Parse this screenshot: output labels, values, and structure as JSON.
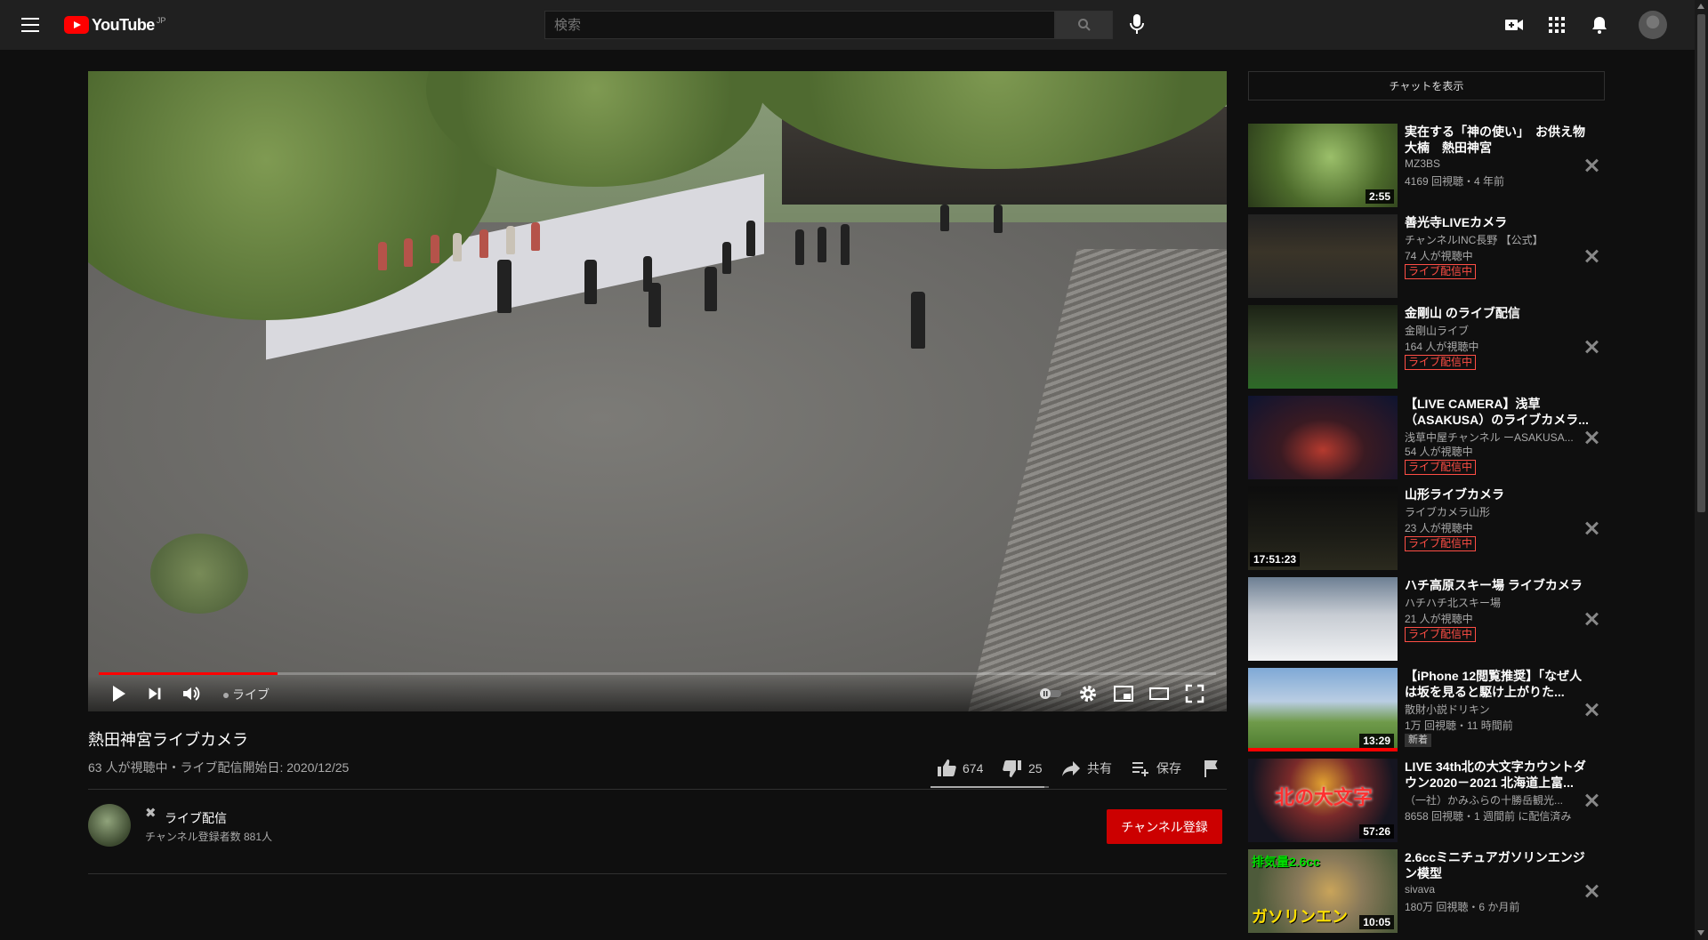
{
  "topbar": {
    "logo_text": "YouTube",
    "logo_region": "JP",
    "search_placeholder": "検索"
  },
  "player": {
    "progress_fraction": 0.16,
    "live_label": "ライブ"
  },
  "video": {
    "title": "熱田神宮ライブカメラ",
    "info": "63 人が視聴中・ライブ配信開始日: 2020/12/25",
    "likes": "674",
    "dislikes": "25",
    "like_ratio": 0.96,
    "share_label": "共有",
    "save_label": "保存"
  },
  "channel": {
    "name": "ライブ配信",
    "subscribers": "チャンネル登録者数 881人",
    "subscribe_label": "チャンネル登録"
  },
  "sidebar": {
    "chat_label": "チャットを表示",
    "live_badge": "ライブ配信中",
    "new_badge": "新着",
    "recommendations": [
      {
        "title": "実在する「神の使い」　お供え物　大楠　熱田神宮",
        "channel": "MZ3BS",
        "meta": "4169 回視聴・4 年前",
        "duration": "2:55"
      },
      {
        "title": "善光寺LIVEカメラ",
        "channel": "チャンネルINC長野 【公式】",
        "meta": "74 人が視聴中"
      },
      {
        "title": "金剛山 のライブ配信",
        "channel": "金剛山ライブ",
        "meta": "164 人が視聴中"
      },
      {
        "title": "【LIVE CAMERA】浅草（ASAKUSA）のライブカメラ...",
        "channel": "浅草中屋チャンネル ーASAKUSA...",
        "meta": "54 人が視聴中"
      },
      {
        "title": "山形ライブカメラ",
        "channel": "ライブカメラ山形",
        "meta": "23 人が視聴中",
        "overlay": "17:51:23"
      },
      {
        "title": "ハチ高原スキー場 ライブカメラ",
        "channel": "ハチハチ北スキー場",
        "meta": "21 人が視聴中"
      },
      {
        "title": "【iPhone 12閲覧推奨】「なぜ人は坂を見ると駆け上がりた...",
        "channel": "散財小説ドリキン",
        "meta": "1万 回視聴・11 時間前",
        "duration": "13:29"
      },
      {
        "title": "LIVE 34th北の大文字カウントダウン2020－2021 北海道上富...",
        "channel": "（一社）かみふらの十勝岳観光...",
        "meta": "8658 回視聴・1 週間前 に配信済み",
        "duration": "57:26",
        "thumb_text": "北の大文字"
      },
      {
        "title": "2.6ccミニチュアガソリンエンジン模型",
        "channel": "sivava",
        "meta": "180万 回視聴・6 か月前",
        "duration": "10:05",
        "thumb_text_top": "排気量2.6cc",
        "thumb_text": "ガソリンエン"
      }
    ]
  },
  "colors": {
    "brand_red": "#ff0000",
    "subscribe_red": "#cc0000",
    "live_badge": "#ff4e45",
    "background": "#0f0f0f",
    "topbar": "#202020"
  }
}
